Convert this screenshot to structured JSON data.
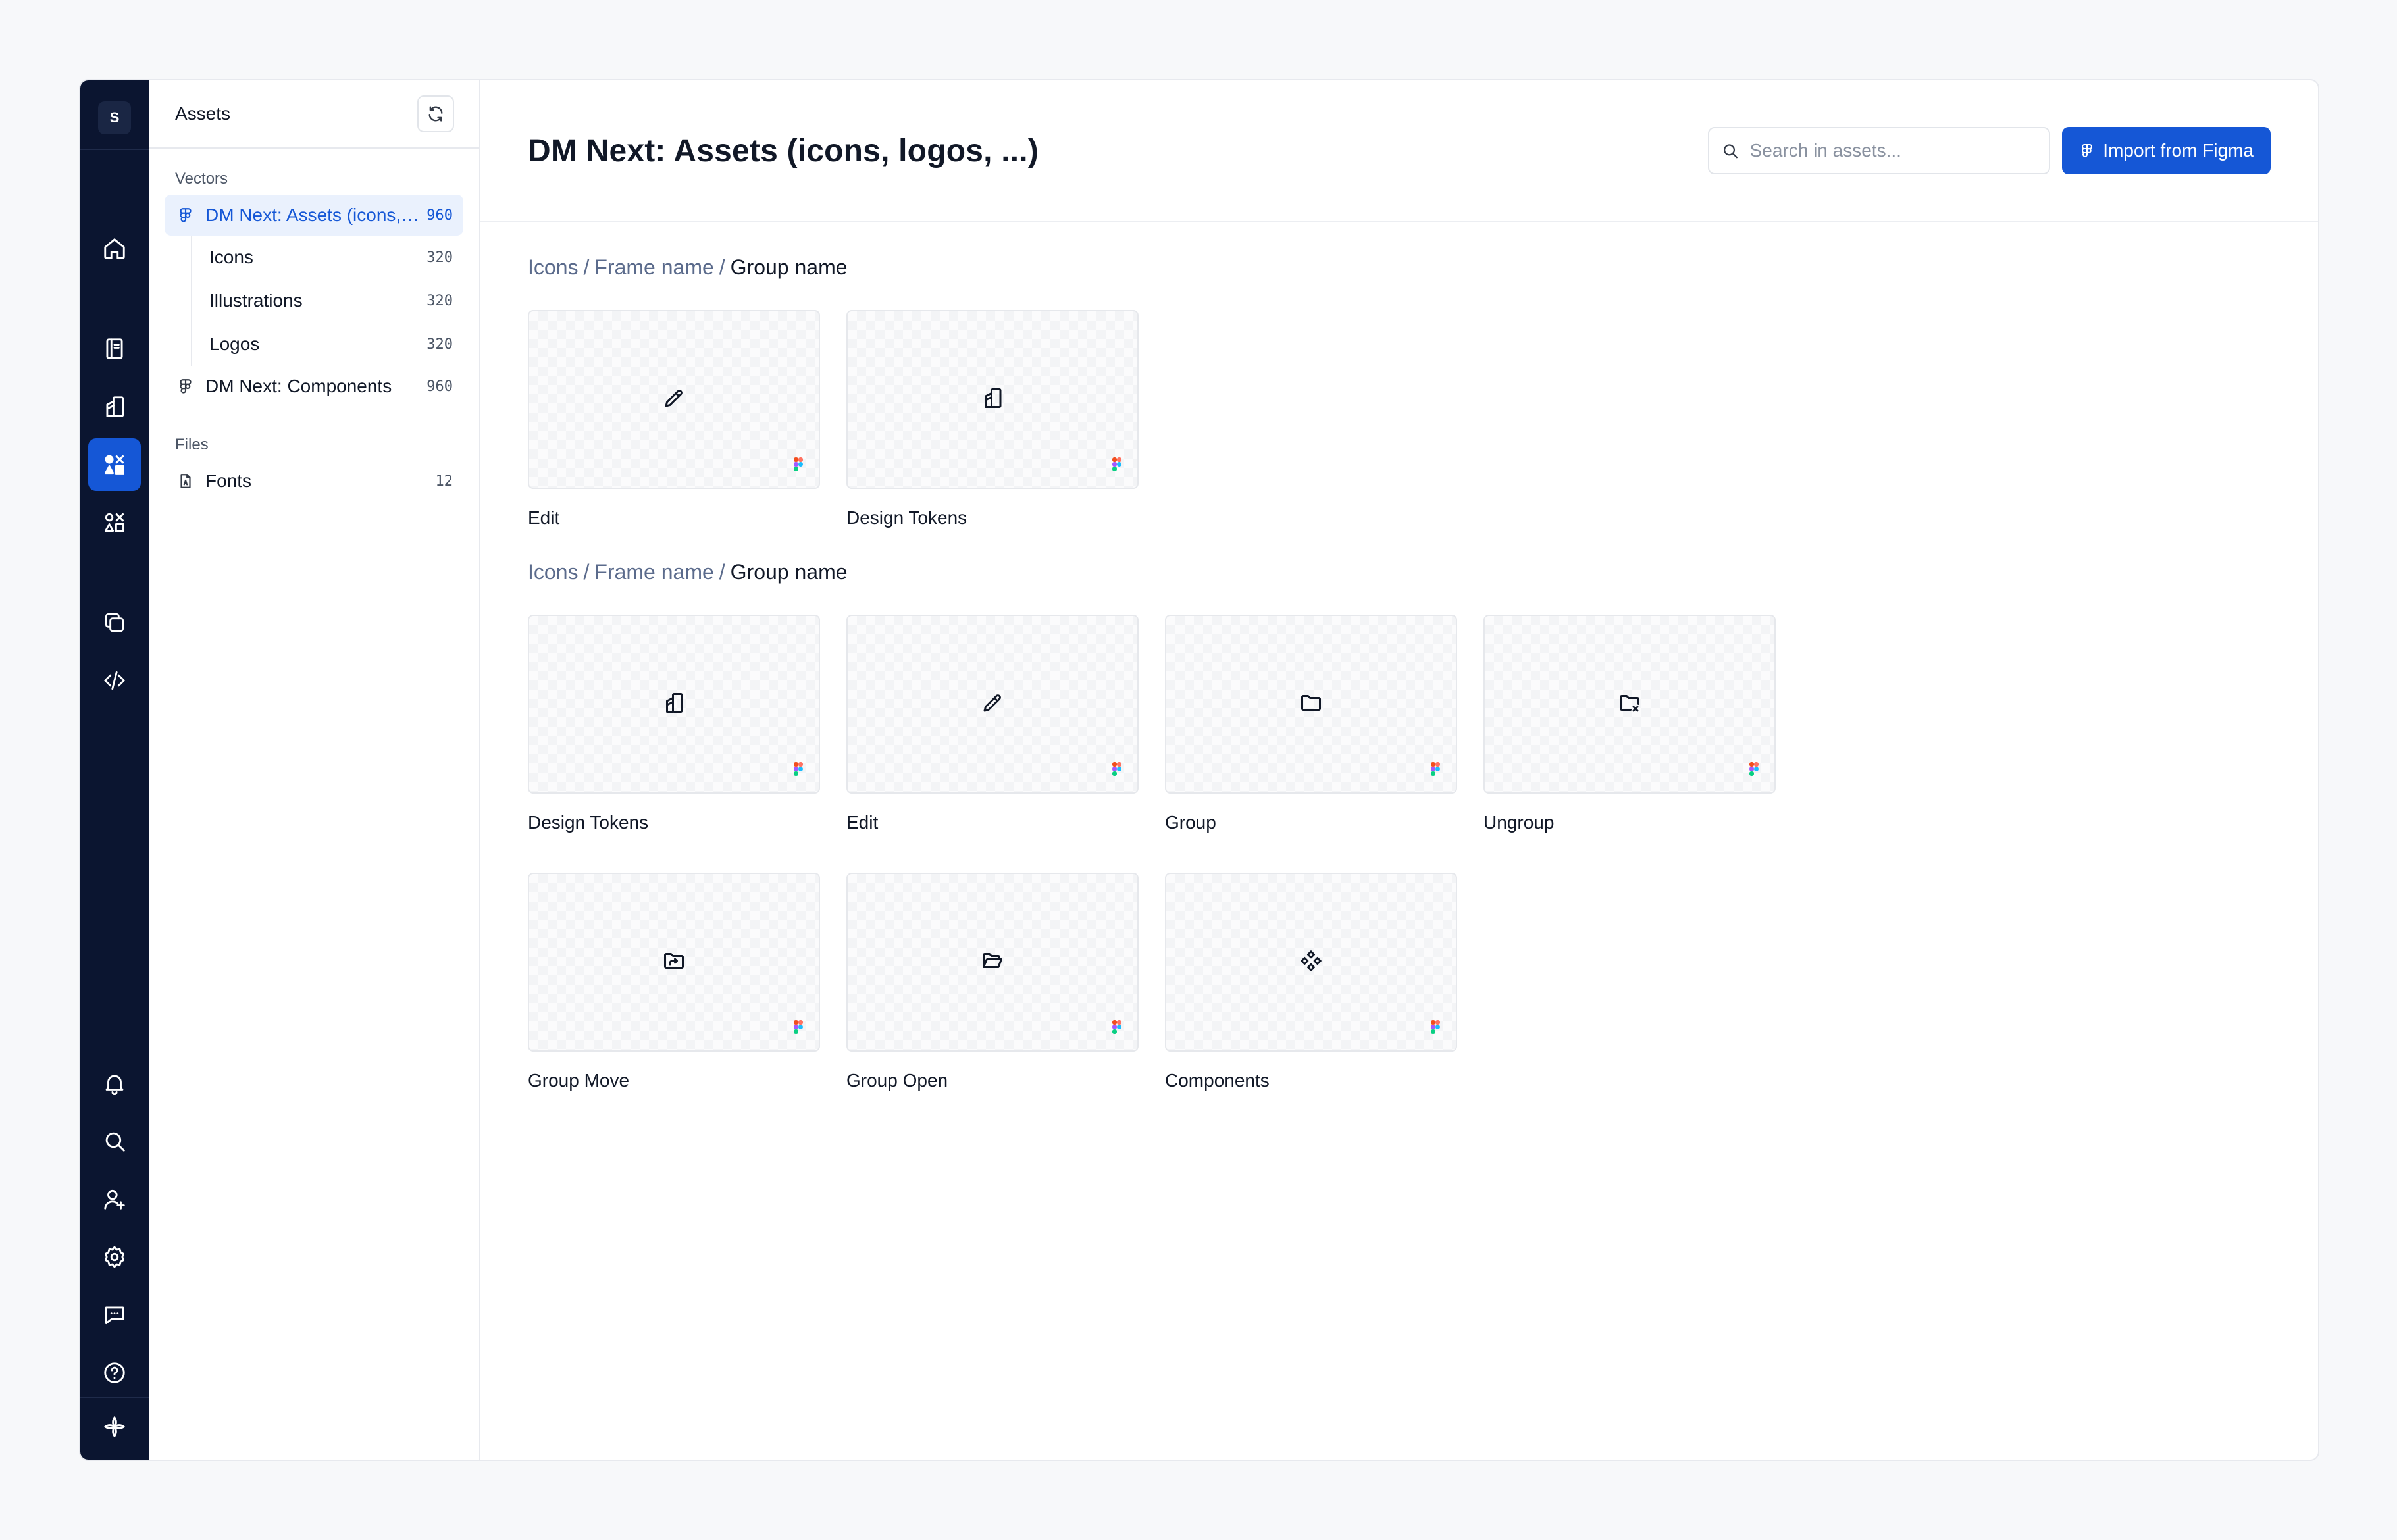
{
  "rail": {
    "avatar_initial": "S"
  },
  "sidebar": {
    "title": "Assets",
    "sections": {
      "vectors_label": "Vectors",
      "files_label": "Files"
    },
    "items": [
      {
        "label": "DM Next: Assets (icons, logos, ...)",
        "count": "960"
      },
      {
        "label": "Icons",
        "count": "320"
      },
      {
        "label": "Illustrations",
        "count": "320"
      },
      {
        "label": "Logos",
        "count": "320"
      },
      {
        "label": "DM Next: Components",
        "count": "960"
      },
      {
        "label": "Fonts",
        "count": "12"
      }
    ]
  },
  "header": {
    "title": "DM Next: Assets (icons, logos, ...)",
    "search_placeholder": "Search in assets...",
    "import_label": "Import from Figma"
  },
  "groups": [
    {
      "breadcrumb": {
        "part1": "Icons",
        "part2": "Frame name",
        "current": "Group name",
        "sep": "/"
      },
      "cards": [
        {
          "label": "Edit",
          "icon": "pencil-icon"
        },
        {
          "label": "Design Tokens",
          "icon": "design-tokens-icon"
        }
      ]
    },
    {
      "breadcrumb": {
        "part1": "Icons",
        "part2": "Frame name",
        "current": "Group name",
        "sep": "/"
      },
      "cards": [
        {
          "label": "Design Tokens",
          "icon": "design-tokens-icon"
        },
        {
          "label": "Edit",
          "icon": "pencil-icon"
        },
        {
          "label": "Group",
          "icon": "folder-icon"
        },
        {
          "label": "Ungroup",
          "icon": "folder-x-icon"
        },
        {
          "label": "Group Move",
          "icon": "folder-move-icon"
        },
        {
          "label": "Group Open",
          "icon": "folder-open-icon"
        },
        {
          "label": "Components",
          "icon": "component-icon"
        }
      ]
    }
  ],
  "colors": {
    "accent": "#1557d6",
    "rail_bg": "#0b1530",
    "active_bg": "#eaf1fd"
  }
}
